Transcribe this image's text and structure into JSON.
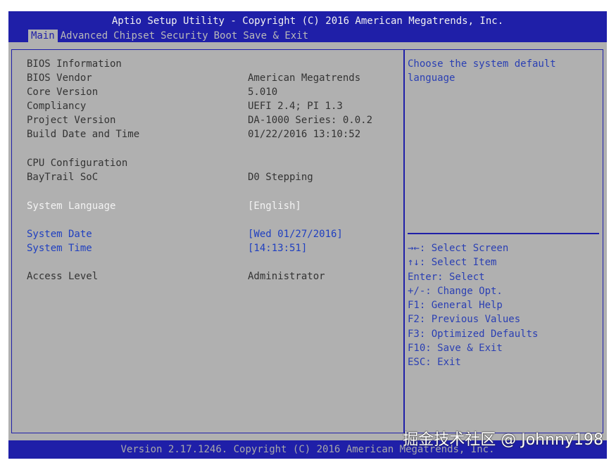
{
  "title": "Aptio Setup Utility - Copyright (C) 2016 American Megatrends, Inc.",
  "tabs": [
    "Main",
    "Advanced",
    "Chipset",
    "Security",
    "Boot",
    "Save & Exit"
  ],
  "main": {
    "bios_info_heading": "BIOS Information",
    "bios_vendor": {
      "label": "BIOS Vendor",
      "value": "American Megatrends"
    },
    "core_version": {
      "label": "Core Version",
      "value": "5.010"
    },
    "compliancy": {
      "label": "Compliancy",
      "value": "UEFI 2.4; PI 1.3"
    },
    "project_version": {
      "label": "Project Version",
      "value": "DA-1000 Series: 0.0.2"
    },
    "build_date": {
      "label": "Build Date and Time",
      "value": "01/22/2016 13:10:52"
    },
    "cpu_config_heading": "CPU Configuration",
    "baytrail": {
      "label": "BayTrail SoC",
      "value": "D0 Stepping"
    },
    "system_language": {
      "label": "System Language",
      "value": "[English]"
    },
    "system_date": {
      "label": "System Date",
      "value": "[Wed 01/27/2016]"
    },
    "system_time": {
      "label": "System Time",
      "value": "[14:13:51]"
    },
    "access_level": {
      "label": "Access Level",
      "value": "Administrator"
    }
  },
  "help": {
    "line1": "Choose the system default",
    "line2": "language"
  },
  "keys": [
    "→←: Select Screen",
    "↑↓: Select Item",
    "Enter: Select",
    "+/-: Change Opt.",
    "F1: General Help",
    "F2: Previous Values",
    "F3: Optimized Defaults",
    "F10: Save & Exit",
    "ESC: Exit"
  ],
  "footer": "Version 2.17.1246. Copyright (C) 2016 American Megatrends, Inc.",
  "watermark": "掘金技术社区 @ Johnny198",
  "colors": {
    "blue_bar": "#1f1fa8",
    "panel_gray": "#b0b0b0",
    "link_blue": "#1f3fc0",
    "selected_white": "#f3f3f3"
  }
}
